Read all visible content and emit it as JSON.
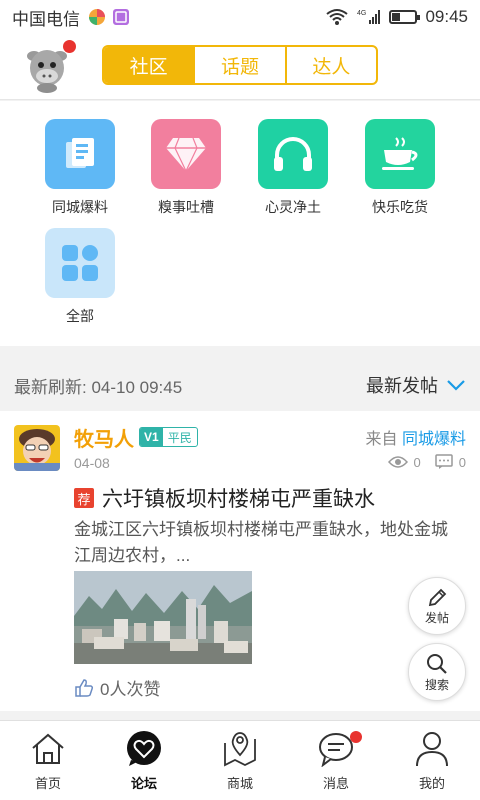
{
  "status_bar": {
    "carrier": "中国电信",
    "time": "09:45",
    "network": "4G"
  },
  "header": {
    "tabs": [
      {
        "label": "社区",
        "active": true
      },
      {
        "label": "话题",
        "active": false
      },
      {
        "label": "达人",
        "active": false
      }
    ]
  },
  "categories": [
    {
      "label": "同城爆料",
      "icon": "news-icon",
      "color": "#5fb8f5"
    },
    {
      "label": "糗事吐槽",
      "icon": "diamond-icon",
      "color": "#f27f9e"
    },
    {
      "label": "心灵净土",
      "icon": "headphones-icon",
      "color": "#1fd1a3"
    },
    {
      "label": "快乐吃货",
      "icon": "teacup-icon",
      "color": "#23d49e"
    },
    {
      "label": "全部",
      "icon": "grid-icon",
      "color": "#c9e6fa"
    }
  ],
  "feed": {
    "refresh_text": "最新刷新: 04-10 09:45",
    "sort_label": "最新发帖"
  },
  "post": {
    "username": "牧马人",
    "badge_v": "V1",
    "badge_level": "平民",
    "from_prefix": "来自",
    "source": "同城爆料",
    "date": "04-08",
    "views": "0",
    "comments": "0",
    "tag": "荐",
    "title": "六圩镇板坝村楼梯屯严重缺水",
    "excerpt": "金城江区六圩镇板坝村楼梯屯严重缺水，地处金城江周边农村，...",
    "likes": "0人次赞"
  },
  "fabs": {
    "post_label": "发帖",
    "search_label": "搜索"
  },
  "bottom_nav": [
    {
      "label": "首页",
      "icon": "home-icon"
    },
    {
      "label": "论坛",
      "icon": "forum-icon",
      "active": true
    },
    {
      "label": "商城",
      "icon": "map-pin-icon"
    },
    {
      "label": "消息",
      "icon": "message-icon",
      "badge": true
    },
    {
      "label": "我的",
      "icon": "user-icon"
    }
  ],
  "colors": {
    "accent": "#f2b709",
    "link": "#1a9be6",
    "badge": "#e8332f"
  }
}
